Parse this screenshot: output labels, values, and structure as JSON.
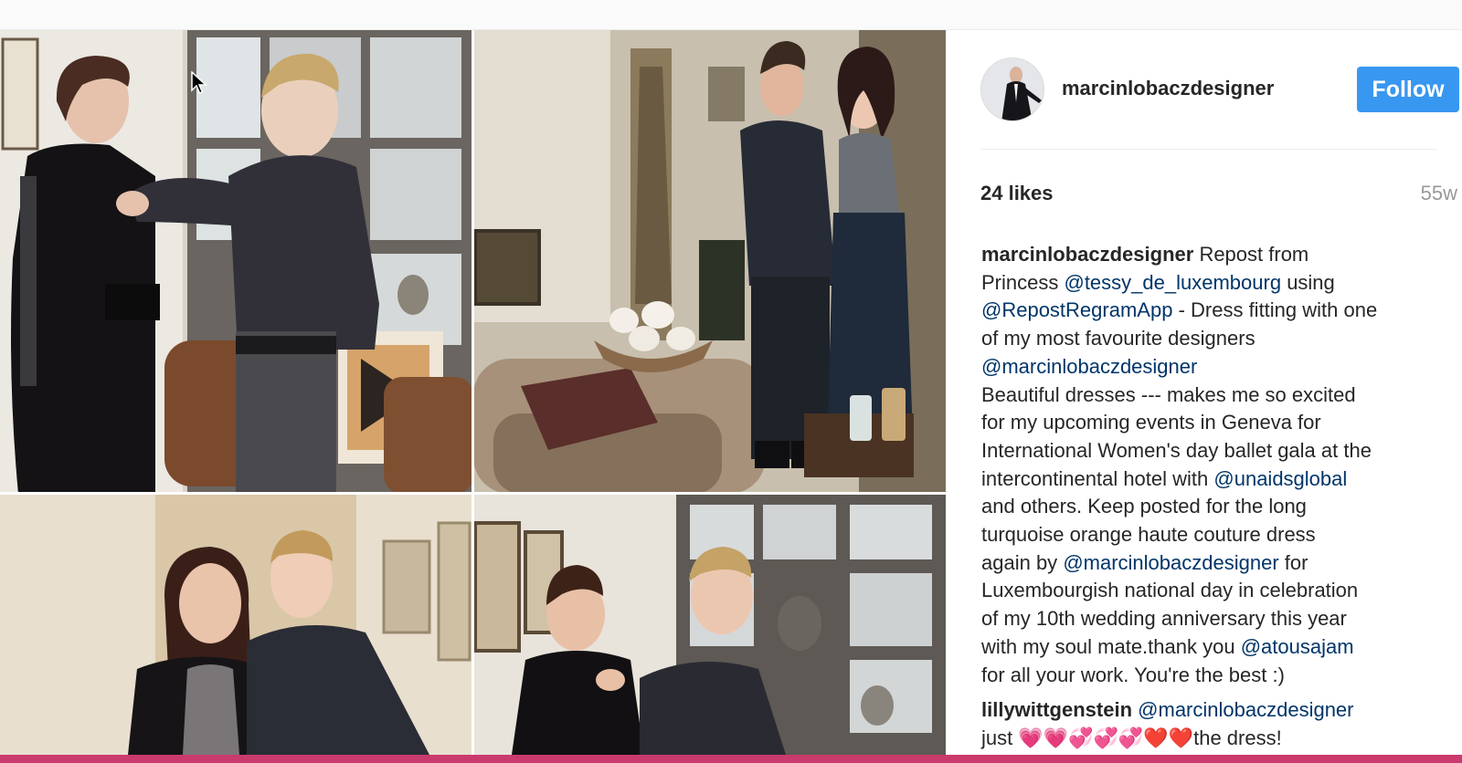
{
  "post": {
    "username": "marcinlobaczdesigner",
    "follow_label": "Follow",
    "likes": "24 likes",
    "age": "55w"
  },
  "caption": {
    "author": "marcinlobaczdesigner",
    "t1": "Repost from",
    "t2": "Princess",
    "m1": "@tessy_de_luxembourg",
    "t3": "using",
    "m2": "@RepostRegramApp",
    "t4": "- Dress fitting with one",
    "t5": "of my most favourite designers",
    "m3": "@marcinlobaczdesigner",
    "t6": "Beautiful dresses --- makes me so excited",
    "t7": "for my upcoming events in Geneva for",
    "t8": "International Women's day ballet gala at the",
    "t9": "intercontinental hotel with",
    "m4": "@unaidsglobal",
    "t10": "and others. Keep posted for the long",
    "t11": "turquoise orange haute couture dress",
    "t12": "again by",
    "m5": "@marcinlobaczdesigner",
    "t13": "for",
    "t14": "Luxembourgish national day in celebration",
    "t15": "of my 10th wedding anniversary this year",
    "t16": "with my soul mate.thank you",
    "m6": "@atousajam",
    "t17": "for all your work. You're the best :)"
  },
  "comment2": {
    "author": "lillywittgenstein",
    "mention": "@marcinlobaczdesigner",
    "text": "just 💗💗💞💞💞❤️❤️the dress!"
  },
  "icons": {
    "cursor": "mouse-pointer-icon"
  },
  "colors": {
    "follow_button": "#3897f0",
    "mention": "#003569",
    "bottom_bar": "#ca3a6c"
  }
}
